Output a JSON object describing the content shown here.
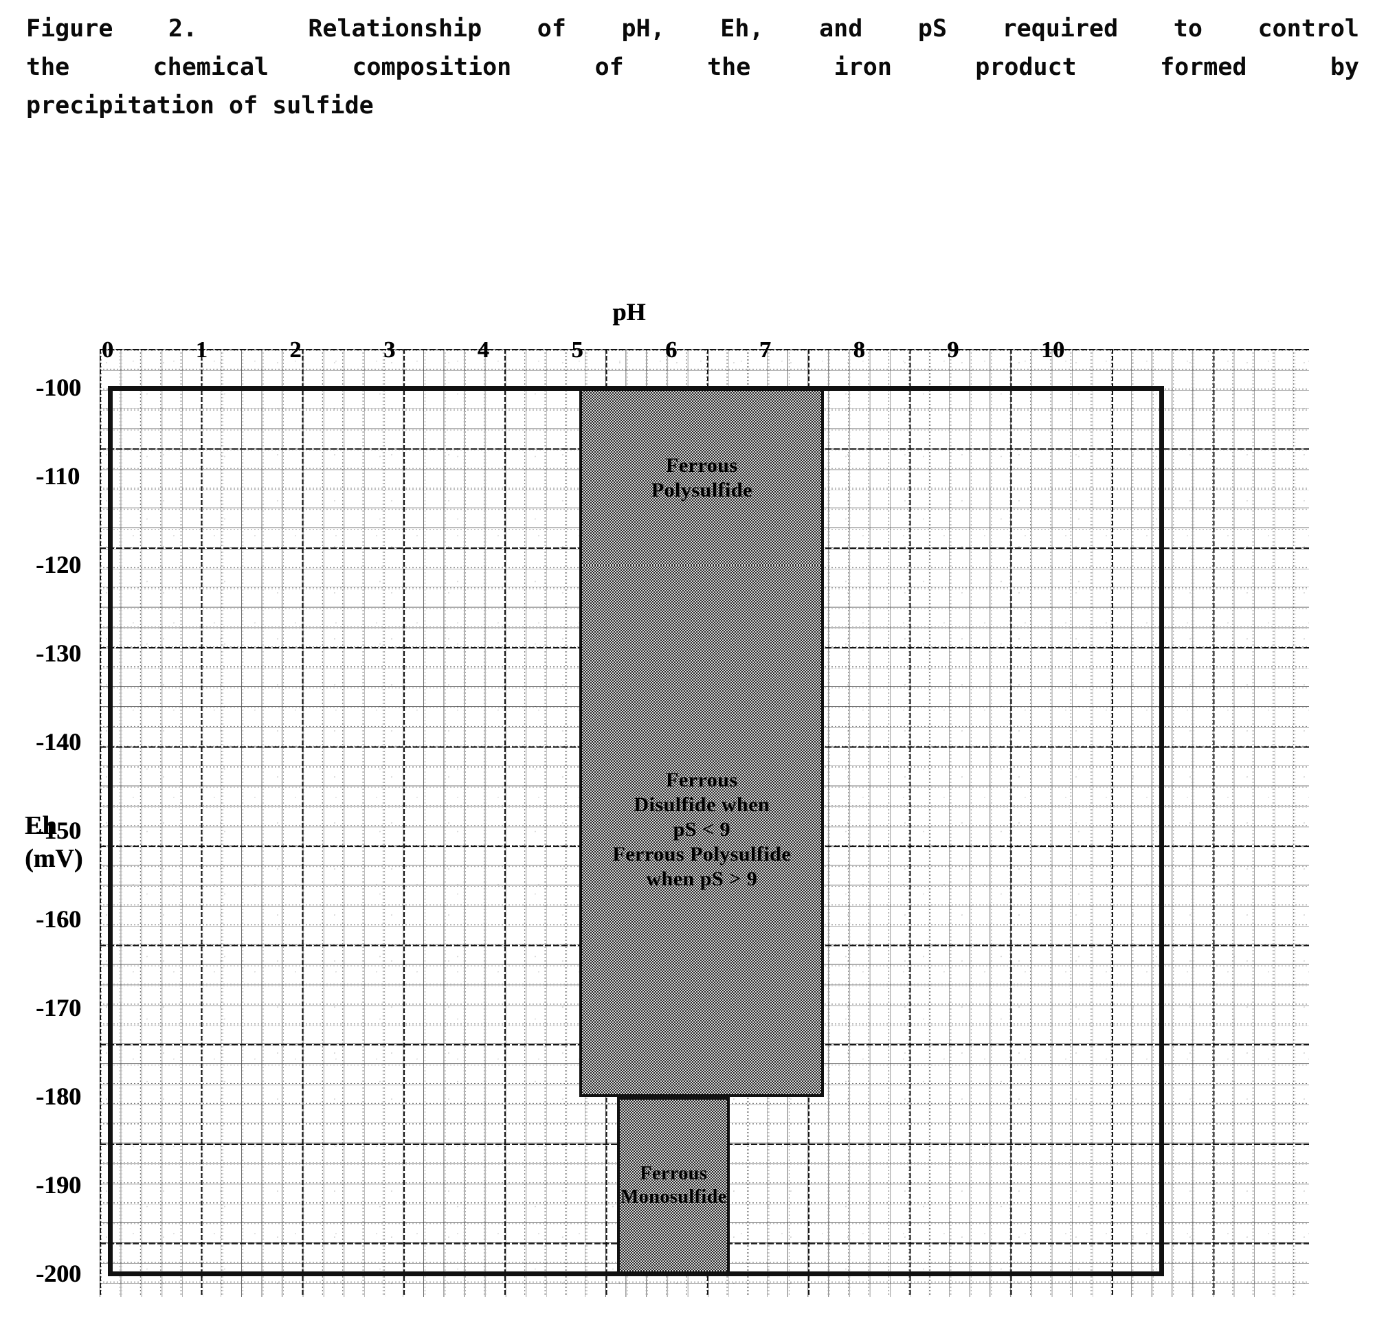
{
  "caption": {
    "line1": "Figure 2.  Relationship of pH, Eh, and pS required to control",
    "line2": "the chemical composition of the iron product formed by",
    "line3": "precipitation of sulfide",
    "full": "Figure 2.  Relationship of pH, Eh, and pS required to control the chemical composition of the iron product formed by precipitation of sulfide"
  },
  "figure": {
    "x_axis_title": "pH",
    "y_axis_title_line1": "Eh",
    "y_axis_title_line2": "(mV)",
    "x_tick_labels": [
      "0",
      "1",
      "2",
      "3",
      "4",
      "5",
      "6",
      "7",
      "8",
      "9",
      "10"
    ],
    "y_tick_labels": [
      "-100",
      "-110",
      "-120",
      "-130",
      "-140",
      "-150",
      "-160",
      "-170",
      "-180",
      "-190",
      "-200"
    ],
    "regions": [
      {
        "name": "ferrous-polysulfide",
        "label": "Ferrous\nPolysulfide",
        "font_size": "30px"
      },
      {
        "name": "ferrous-disulfide-polysulfide",
        "label": "Ferrous\nDisulfide when\npS < 9\nFerrous Polysulfide\nwhen pS > 9",
        "font_size": "30px"
      },
      {
        "name": "ferrous-monosulfide",
        "label": "Ferrous\nMonosulfide",
        "font_size": "28px"
      }
    ]
  },
  "chart_data": {
    "type": "heatmap",
    "title": "Relationship of pH, Eh, and pS required to control the chemical composition of the iron product formed by precipitation of sulfide",
    "xlabel": "pH",
    "ylabel": "Eh (mV)",
    "xlim": [
      0,
      11.2
    ],
    "ylim": [
      -200,
      -100
    ],
    "xticks": [
      0,
      1,
      2,
      3,
      4,
      5,
      6,
      7,
      8,
      9,
      10
    ],
    "yticks": [
      -100,
      -110,
      -120,
      -130,
      -140,
      -150,
      -160,
      -170,
      -180,
      -190,
      -200
    ],
    "grid": true,
    "grid_minor": true,
    "legend": "none",
    "regions": [
      {
        "label": "Ferrous Polysulfide",
        "ph_range": [
          5.0,
          7.6
        ],
        "eh_range": [
          -120,
          -100
        ],
        "fill": "#9a9a9a",
        "note": "upper shaded block"
      },
      {
        "label": "Ferrous Disulfide when pS < 9 / Ferrous Polysulfide when pS > 9",
        "ph_range": [
          5.0,
          7.6
        ],
        "eh_range": [
          -180,
          -120
        ],
        "fill": "#9a9a9a",
        "note": "tall central shaded block"
      },
      {
        "label": "Ferrous Monosulfide",
        "ph_range": [
          5.4,
          6.6
        ],
        "eh_range": [
          -200,
          -180
        ],
        "fill": "#9a9a9a",
        "note": "lower narrow shaded block"
      }
    ],
    "unshaded_note": "All area outside the three shaded blocks is blank graph paper (no iron sulfide product designated).",
    "annotations": [
      {
        "text": "pS < 9",
        "meaning": "Ferrous Disulfide forms"
      },
      {
        "text": "pS > 9",
        "meaning": "Ferrous Polysulfide forms"
      }
    ]
  },
  "colors": {
    "ink": "#0a0a0a",
    "shade_fill": "#9a9a9a",
    "paper": "#ffffff"
  }
}
